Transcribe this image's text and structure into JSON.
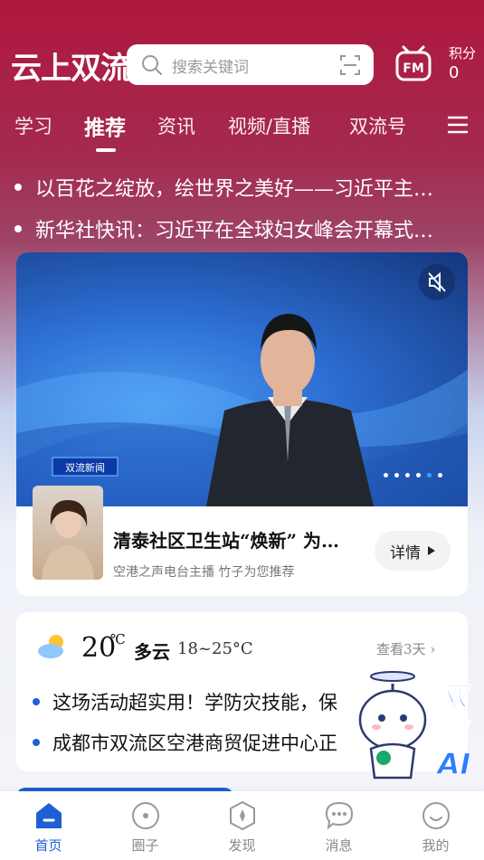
{
  "header": {
    "logo": "云上双流",
    "search_placeholder": "搜索关键词",
    "points_label": "积分",
    "points_value": "0"
  },
  "tabs": [
    {
      "label": "学习"
    },
    {
      "label": "推荐",
      "active": true
    },
    {
      "label": "资讯"
    },
    {
      "label": "视频/直播"
    },
    {
      "label": "双流号"
    }
  ],
  "headlines": [
    "以百花之绽放，绘世界之美好——习近平主…",
    "新华社快讯：习近平在全球妇女峰会开幕式…"
  ],
  "featured": {
    "video_caption": "双流新闻",
    "title": "清泰社区卫生站“焕新”  为…",
    "subtitle": "空港之声电台主播  竹子为您推荐",
    "detail_label": "详情",
    "carousel_index": 5,
    "carousel_count": 6
  },
  "weather": {
    "temp": "20",
    "unit": "℃",
    "condition": "多云",
    "range": "18~25°C",
    "forecast_link": "查看3天"
  },
  "news": [
    "这场活动超实用！学防灾技能，保",
    "成都市双流区空港商贸促进中心正"
  ],
  "mascot_label": "双融AI",
  "bottom_nav": [
    {
      "label": "首页",
      "icon": "home-icon",
      "active": true
    },
    {
      "label": "圈子",
      "icon": "circle-icon"
    },
    {
      "label": "发现",
      "icon": "compass-icon"
    },
    {
      "label": "消息",
      "icon": "message-icon"
    },
    {
      "label": "我的",
      "icon": "profile-icon"
    }
  ],
  "colors": {
    "brand_red": "#b0173d",
    "accent_blue": "#1e5fd6"
  }
}
